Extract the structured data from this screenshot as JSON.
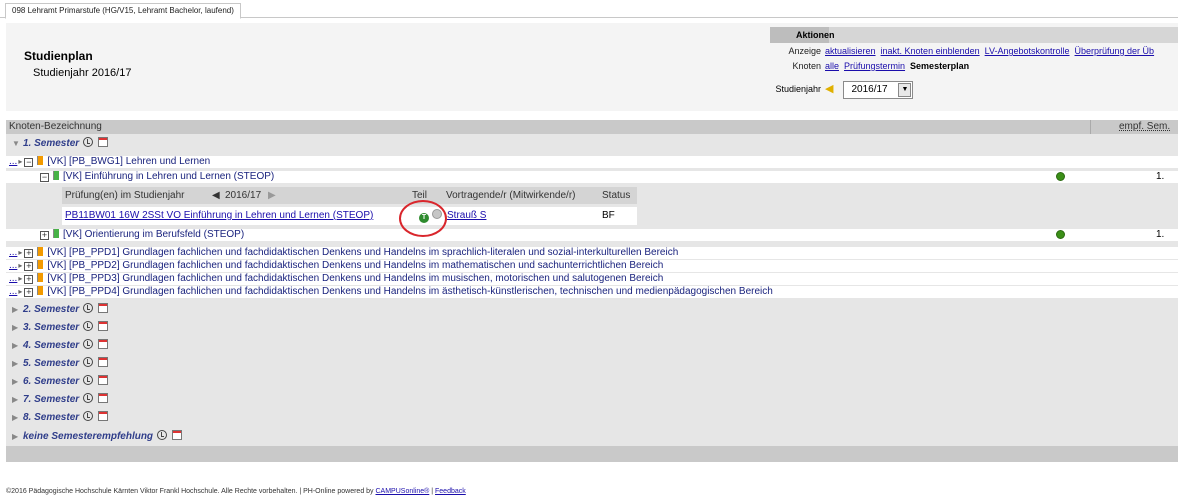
{
  "tab": {
    "label": "098 Lehramt Primarstufe (HG/V15, Lehramt Bachelor, laufend)"
  },
  "header": {
    "title": "Studienplan",
    "subtitle": "Studienjahr 2016/17"
  },
  "aktionen": {
    "heading": "Aktionen",
    "anzeige_label": "Anzeige",
    "anzeige_links": [
      "aktualisieren",
      "inakt. Knoten einblenden",
      "LV-Angebotskontrolle",
      "Überprüfung der Üb"
    ],
    "knoten_label": "Knoten",
    "knoten_links": [
      "alle",
      "Prüfungstermin"
    ],
    "knoten_current": "Semesterplan",
    "studienjahr_label": "Studienjahr",
    "studienjahr_value": "2016/17"
  },
  "table": {
    "col_knoten": "Knoten-Bezeichnung",
    "col_sem": "empf. Sem.",
    "semester1": "1. Semester",
    "dots": "...",
    "node_bwg1": "[VK] [PB_BWG1] Lehren und Lernen",
    "node_einf": "[VK] Einführung in Lehren und Lernen (STEOP)",
    "einf_sem": "1.",
    "exam": {
      "col_pruefung": "Prüfung(en) im Studienjahr",
      "col_year": "2016/17",
      "col_teil": "Teil",
      "col_vortr": "Vortragende/r (Mitwirkende/r)",
      "col_status": "Status",
      "course_link": "PB11BW01 16W 2SSt VO Einführung in Lehren und Lernen (STEOP)",
      "t_label": "T",
      "lecturer": "Strauß S",
      "status": "BF"
    },
    "node_orient": "[VK] Orientierung im Berufsfeld (STEOP)",
    "orient_sem": "1.",
    "node_ppd1": "[VK] [PB_PPD1] Grundlagen fachlichen und fachdidaktischen Denkens und Handelns im sprachlich-literalen und sozial-interkulturellen Bereich",
    "node_ppd2": "[VK] [PB_PPD2] Grundlagen fachlichen und fachdidaktischen Denkens und Handelns im mathematischen und sachunterrichtlichen Bereich",
    "node_ppd3": "[VK] [PB_PPD3] Grundlagen fachlichen und fachdidaktischen Denkens und Handelns im musischen, motorischen und salutogenen Bereich",
    "node_ppd4": "[VK] [PB_PPD4] Grundlagen fachlichen und fachdidaktischen Denkens und Handelns im ästhetisch-künstlerischen, technischen und medienpädagogischen Bereich",
    "semesters": [
      "2. Semester",
      "3. Semester",
      "4. Semester",
      "5. Semester",
      "6. Semester",
      "7. Semester",
      "8. Semester",
      "keine Semesterempfehlung"
    ]
  },
  "footer": {
    "text": "©2016 Pädagogische Hochschule Kärnten Viktor Frankl Hochschule. Alle Rechte vorbehalten. | PH-Online powered by ",
    "link": "CAMPUSonline®",
    "sep": " | ",
    "feedback": "Feedback"
  }
}
